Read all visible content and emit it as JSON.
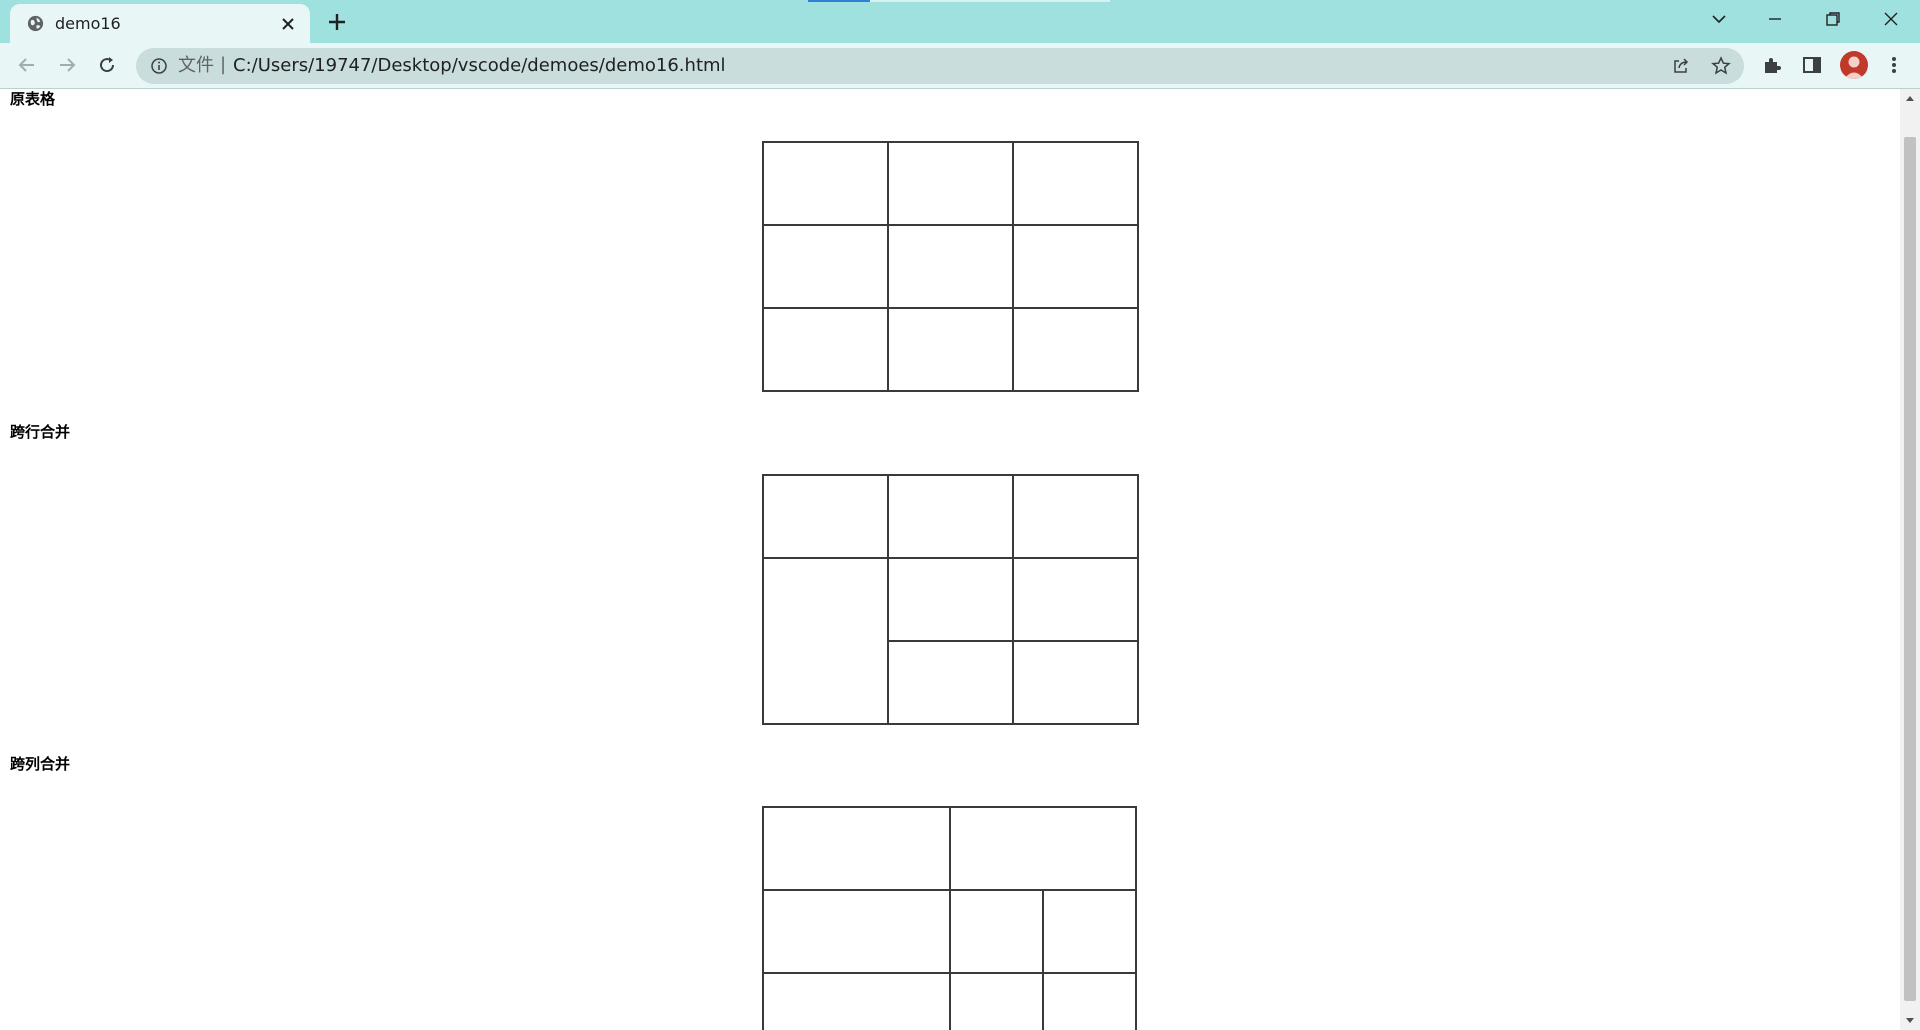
{
  "browser": {
    "tab": {
      "title": "demo16"
    },
    "address_bar": {
      "scheme_label": "文件",
      "separator": "|",
      "url": "C:/Users/19747/Desktop/vscode/demoes/demo16.html"
    },
    "colors": {
      "tabstrip": "#9fe1de",
      "toolbar": "#e8f6f5",
      "omnibox": "#c9dddc",
      "avatar": "#c0392b"
    }
  },
  "page": {
    "sections": [
      {
        "title": "原表格"
      },
      {
        "title": "跨行合并"
      },
      {
        "title": "跨列合并"
      }
    ],
    "table_border_color": "#3a3a3a"
  }
}
